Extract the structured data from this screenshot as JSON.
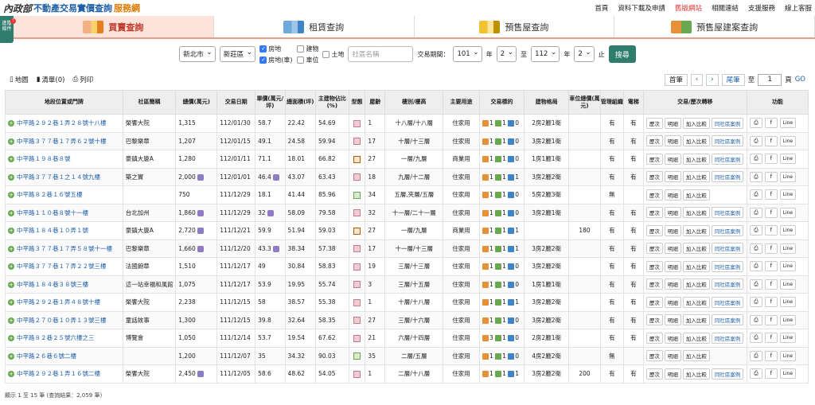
{
  "header": {
    "logo_mark": "內政部",
    "logo_title": "不動產交易實價查詢",
    "logo_sub": "服務網",
    "nav": [
      "首頁",
      "資料下載及申請",
      "舊版網站",
      "相關連結",
      "支援服務",
      "線上客服"
    ]
  },
  "side_badge": {
    "label": "進階條件",
    "count": "!"
  },
  "tabs": [
    "買賣查詢",
    "租賃查詢",
    "預售屋查詢",
    "預售屋建案查詢"
  ],
  "filters": {
    "city": "新北市",
    "district": "新莊區",
    "checks": [
      {
        "label": "房地",
        "on": true
      },
      {
        "label": "建物",
        "on": false
      },
      {
        "label": "土地",
        "on": false
      },
      {
        "label": "房地(車)",
        "on": true
      },
      {
        "label": "車位",
        "on": false
      }
    ],
    "community_placeholder": "社區名稱",
    "period_label": "交易期間：",
    "from_year": "101",
    "year_unit": "年",
    "from_month": "2",
    "to_label": "至",
    "to_year": "112",
    "to_month": "2",
    "end_label": "止",
    "search_label": "搜尋"
  },
  "toolbar": {
    "map": "地圖",
    "list": "清單(0)",
    "print": "列印",
    "first": "首筆",
    "last": "尾筆",
    "to": "至",
    "page": "1",
    "page_unit": "頁",
    "go": "GO"
  },
  "chart_data": {
    "type": "table",
    "columns": [
      "地段位置或門牌",
      "社區簡稱",
      "總價(萬元)",
      "交易日期",
      "單價(萬元/坪)",
      "總面積(坪)",
      "主建物佔比(%)",
      "型態",
      "屋齡",
      "樓別/樓高",
      "主要用途",
      "交易標的",
      "建物格局",
      "車位總價(萬元)",
      "管理組織",
      "電梯",
      "交易/歷次轉移",
      "功能"
    ],
    "rows": [
      {
        "addr": "中平路２９２巷１弄２８號十八樓",
        "name": "榮饗大院",
        "price": "1,315",
        "date": "112/01/30",
        "unit": "58.7",
        "area": "22.42",
        "ratio": "54.69",
        "type": "p",
        "age": "1",
        "floor": "十八層/十八層",
        "use": "住家用",
        "target": [
          "1",
          "1",
          "0"
        ],
        "layout": "2房2廳1衛",
        "park": "",
        "mgmt": "有",
        "elev": "有",
        "tag_price": false,
        "tag_unit": false,
        "compare": true
      },
      {
        "addr": "中平路３７７巷１７弄６２號十樓",
        "name": "巴黎樂章",
        "price": "1,207",
        "date": "112/01/15",
        "unit": "49.1",
        "area": "24.58",
        "ratio": "59.94",
        "type": "p",
        "age": "17",
        "floor": "十層/十三層",
        "use": "住家用",
        "target": [
          "1",
          "1",
          "0"
        ],
        "layout": "3房2廳1衛",
        "park": "",
        "mgmt": "有",
        "elev": "有",
        "tag_price": false,
        "tag_unit": false,
        "compare": true
      },
      {
        "addr": "中平路１９８巷８號",
        "name": "豪鎮大廈A",
        "price": "1,280",
        "date": "112/01/11",
        "unit": "71.1",
        "area": "18.01",
        "ratio": "66.82",
        "type": "o",
        "age": "27",
        "floor": "一層/九層",
        "use": "商業用",
        "target": [
          "1",
          "1",
          "0"
        ],
        "layout": "1房1廳1衛",
        "park": "",
        "mgmt": "有",
        "elev": "有",
        "tag_price": false,
        "tag_unit": false,
        "compare": true
      },
      {
        "addr": "中平路３７７巷１之１４號九樓",
        "name": "築之實",
        "price": "2,000",
        "date": "112/01/01",
        "unit": "46.4",
        "area": "43.07",
        "ratio": "63.43",
        "type": "p",
        "age": "18",
        "floor": "九層/十二層",
        "use": "住家用",
        "target": [
          "1",
          "1",
          "1"
        ],
        "layout": "3房2廳2衛",
        "park": "",
        "mgmt": "有",
        "elev": "有",
        "tag_price": true,
        "tag_unit": true,
        "compare": true
      },
      {
        "addr": "中平路８２巷１６號五樓",
        "name": "",
        "price": "750",
        "date": "111/12/29",
        "unit": "18.1",
        "area": "41.44",
        "ratio": "85.96",
        "type": "g",
        "age": "34",
        "floor": "五層,夾層/五層",
        "use": "住家用",
        "target": [
          "1",
          "1",
          "0"
        ],
        "layout": "5房2廳3衛",
        "park": "",
        "mgmt": "無",
        "elev": "",
        "tag_price": false,
        "tag_unit": false,
        "compare": false
      },
      {
        "addr": "中平路１１０巷８號十一樓",
        "name": "台北加州",
        "price": "1,860",
        "date": "111/12/29",
        "unit": "32",
        "area": "58.09",
        "ratio": "79.58",
        "type": "p",
        "age": "32",
        "floor": "十一層/二十一層",
        "use": "住家用",
        "target": [
          "1",
          "1",
          "0"
        ],
        "layout": "3房2廳1衛",
        "park": "",
        "mgmt": "有",
        "elev": "有",
        "tag_price": true,
        "tag_unit": true,
        "compare": true
      },
      {
        "addr": "中平路１８４巷１０弄１號",
        "name": "豪鎮大廈A",
        "price": "2,720",
        "date": "111/12/21",
        "unit": "59.9",
        "area": "51.94",
        "ratio": "59.03",
        "type": "o",
        "age": "27",
        "floor": "一層/九層",
        "use": "商業用",
        "target": [
          "1",
          "1",
          "1"
        ],
        "layout": "",
        "park": "180",
        "mgmt": "有",
        "elev": "有",
        "tag_price": true,
        "tag_unit": false,
        "compare": true
      },
      {
        "addr": "中平路３７７巷１７弄５８號十一樓",
        "name": "巴黎樂章",
        "price": "1,660",
        "date": "111/12/20",
        "unit": "43.3",
        "area": "38.34",
        "ratio": "57.38",
        "type": "p",
        "age": "17",
        "floor": "十一層/十三層",
        "use": "住家用",
        "target": [
          "1",
          "1",
          "1"
        ],
        "layout": "3房2廳2衛",
        "park": "",
        "mgmt": "有",
        "elev": "有",
        "tag_price": true,
        "tag_unit": true,
        "compare": true
      },
      {
        "addr": "中平路３７７巷１７弄２２號三樓",
        "name": "法國飽章",
        "price": "1,510",
        "date": "111/12/17",
        "unit": "49",
        "area": "30.84",
        "ratio": "58.83",
        "type": "p",
        "age": "19",
        "floor": "三層/十三層",
        "use": "住家用",
        "target": [
          "1",
          "1",
          "0"
        ],
        "layout": "3房2廳2衛",
        "park": "",
        "mgmt": "有",
        "elev": "有",
        "tag_price": false,
        "tag_unit": false,
        "compare": true
      },
      {
        "addr": "中平路１８４巷３８號三樓",
        "name": "這一站幸福和風館",
        "price": "1,075",
        "date": "111/12/17",
        "unit": "53.9",
        "area": "19.95",
        "ratio": "55.74",
        "type": "p",
        "age": "3",
        "floor": "三層/十五層",
        "use": "住家用",
        "target": [
          "1",
          "1",
          "0"
        ],
        "layout": "1房1廳1衛",
        "park": "",
        "mgmt": "有",
        "elev": "有",
        "tag_price": false,
        "tag_unit": false,
        "compare": true
      },
      {
        "addr": "中平路２９２巷１弄４８號十樓",
        "name": "榮饗大院",
        "price": "2,238",
        "date": "111/12/15",
        "unit": "58",
        "area": "38.57",
        "ratio": "55.38",
        "type": "p",
        "age": "1",
        "floor": "十層/十八層",
        "use": "住家用",
        "target": [
          "1",
          "1",
          "1"
        ],
        "layout": "3房2廳2衛",
        "park": "",
        "mgmt": "有",
        "elev": "有",
        "tag_price": false,
        "tag_unit": false,
        "compare": true
      },
      {
        "addr": "中平路２７０巷１０弄１３號三樓",
        "name": "童話故事",
        "price": "1,300",
        "date": "111/12/15",
        "unit": "39.8",
        "area": "32.64",
        "ratio": "58.35",
        "type": "p",
        "age": "27",
        "floor": "三層/十六層",
        "use": "住家用",
        "target": [
          "1",
          "1",
          "0"
        ],
        "layout": "3房2廳2衛",
        "park": "",
        "mgmt": "有",
        "elev": "有",
        "tag_price": false,
        "tag_unit": false,
        "compare": true
      },
      {
        "addr": "中平路８２巷２５號六樓之三",
        "name": "博覽會",
        "price": "1,050",
        "date": "111/12/14",
        "unit": "53.7",
        "area": "19.54",
        "ratio": "67.62",
        "type": "p",
        "age": "21",
        "floor": "六層/十四層",
        "use": "住家用",
        "target": [
          "3",
          "1",
          "0"
        ],
        "layout": "2房2廳1衛",
        "park": "",
        "mgmt": "有",
        "elev": "有",
        "tag_price": false,
        "tag_unit": false,
        "compare": true
      },
      {
        "addr": "中平路２６巷６號二樓",
        "name": "",
        "price": "1,200",
        "date": "111/12/07",
        "unit": "35",
        "area": "34.32",
        "ratio": "90.03",
        "type": "g",
        "age": "35",
        "floor": "二層/五層",
        "use": "住家用",
        "target": [
          "1",
          "1",
          "0"
        ],
        "layout": "4房2廳2衛",
        "park": "",
        "mgmt": "無",
        "elev": "",
        "tag_price": false,
        "tag_unit": false,
        "compare": false
      },
      {
        "addr": "中平路２９２巷１弄１６號二樓",
        "name": "榮饗大院",
        "price": "2,450",
        "date": "111/12/05",
        "unit": "58.6",
        "area": "48.62",
        "ratio": "54.05",
        "type": "p",
        "age": "1",
        "floor": "二層/十八層",
        "use": "住家用",
        "target": [
          "1",
          "1",
          "1"
        ],
        "layout": "3房2廳2衛",
        "park": "200",
        "mgmt": "有",
        "elev": "有",
        "tag_price": true,
        "tag_unit": false,
        "compare": true
      }
    ]
  },
  "row_buttons": {
    "history": "歷次",
    "detail": "明細",
    "compare": "加入比較",
    "same": "同社區案例",
    "fb": "f",
    "line": "Line"
  },
  "footer": "顯示 1 至 15 筆 (查詢結果：2,059 筆)"
}
